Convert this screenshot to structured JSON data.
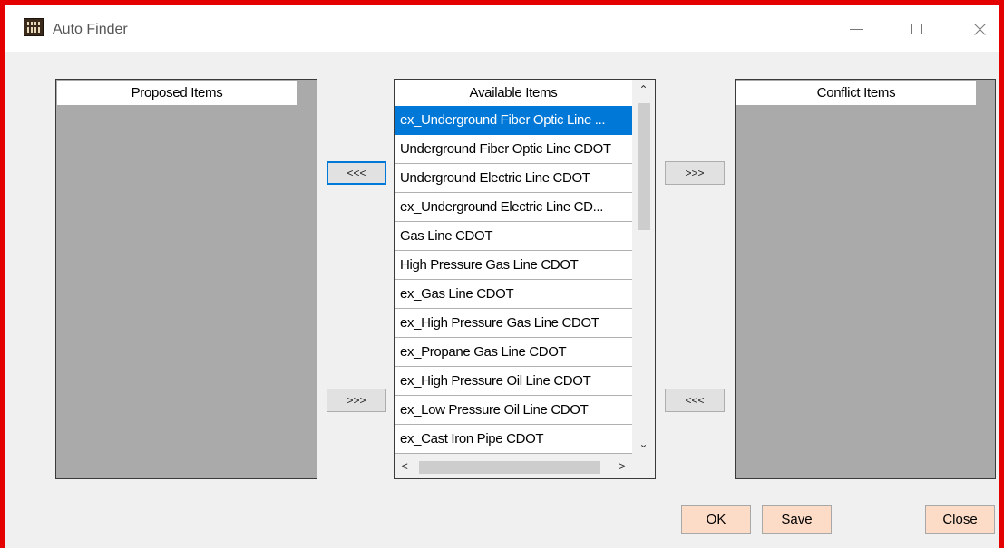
{
  "window": {
    "title": "Auto Finder",
    "icon": "cess-app-icon",
    "controls": [
      "minimize-icon",
      "maximize-icon",
      "close-icon"
    ]
  },
  "proposed": {
    "header": "Proposed Items"
  },
  "available": {
    "header": "Available Items",
    "selected_index": 0,
    "items": [
      "ex_Underground Fiber Optic Line ...",
      "Underground Fiber Optic Line CDOT",
      "Underground Electric Line CDOT",
      "ex_Underground Electric Line CD...",
      "Gas Line CDOT",
      "High Pressure Gas Line CDOT",
      "ex_Gas Line CDOT",
      "ex_High Pressure Gas Line CDOT",
      "ex_Propane Gas Line CDOT",
      "ex_High Pressure Oil Line CDOT",
      "ex_Low Pressure Oil Line CDOT",
      "ex_Cast Iron Pipe CDOT"
    ],
    "scroll_up": "⌃",
    "scroll_down": "⌄",
    "scroll_left": "<",
    "scroll_right": ">"
  },
  "conflict": {
    "header": "Conflict Items"
  },
  "move_buttons": {
    "to_proposed": "<<<",
    "from_proposed": ">>>",
    "to_conflict": ">>>",
    "from_conflict": "<<<"
  },
  "actions": {
    "ok": "OK",
    "save": "Save",
    "close": "Close"
  },
  "colors": {
    "frame_border": "#e50000",
    "selection": "#0078d7",
    "action_button": "#fcdcc6",
    "panel_gray": "#aaaaaa"
  }
}
